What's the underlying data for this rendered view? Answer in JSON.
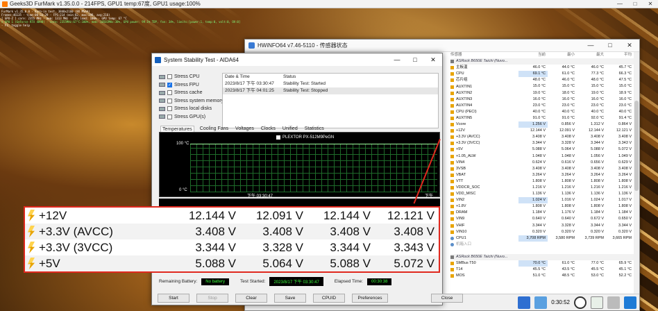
{
  "furmark": {
    "title": "Geeks3D FurMark v1.35.0.0 - 214FPS, GPU1 temp:67度, GPU1 usage:100%",
    "osd": [
      "FurMark v1.35.0.0 - Burn-in test, 3840x2160 (8X MSAA)",
      "Frames:46135 - time:00:33:29 - FPS:214 (min:82, max:298, avg:216)",
      "[ GPU-Z ] core: 2355 MHz - mem: 1313 MHz - GPU load: 100% - GPU temp: 67 °C",
      "> GPU 1 (GeForce RTX 4090) - core: 2355MHz:67°C:100%, mem: 10501MHz:38%, GPU power: 99.1% TDP, fan: 34%, limits:[power:1, temp:0, volt:0, OV:0]",
      "- F1: toggle help"
    ]
  },
  "hwinfo": {
    "title": "HWiNFO64 v7.46-5110 - 传感器状态",
    "headers": [
      "传感器",
      "当前",
      "最小",
      "最大",
      "平均"
    ],
    "rows": [
      {
        "n": "ASRock B650E Taichi (Nuvo...",
        "type": "group"
      },
      {
        "n": "主板温",
        "v": [
          "46.0 °C",
          "44.0 °C",
          "46.0 °C",
          "45.7 °C"
        ]
      },
      {
        "n": "CPU",
        "v": [
          "69.1 °C",
          "61.0 °C",
          "77.3 °C",
          "66.3 °C"
        ],
        "hl": true
      },
      {
        "n": "芯片组",
        "v": [
          "48.0 °C",
          "46.0 °C",
          "48.0 °C",
          "47.5 °C"
        ]
      },
      {
        "n": "AUXTIN1",
        "v": [
          "15.0 °C",
          "15.0 °C",
          "15.0 °C",
          "15.0 °C"
        ]
      },
      {
        "n": "AUXTIN2",
        "v": [
          "19.0 °C",
          "18.0 °C",
          "19.0 °C",
          "18.9 °C"
        ]
      },
      {
        "n": "AUXTIN3",
        "v": [
          "16.0 °C",
          "16.0 °C",
          "16.0 °C",
          "16.0 °C"
        ]
      },
      {
        "n": "AUXTIN4",
        "v": [
          "23.0 °C",
          "23.0 °C",
          "23.0 °C",
          "23.0 °C"
        ]
      },
      {
        "n": "CPU (PECI)",
        "v": [
          "40.0 °C",
          "40.0 °C",
          "40.0 °C",
          "40.0 °C"
        ]
      },
      {
        "n": "AUXTIN5",
        "v": [
          "91.0 °C",
          "91.0 °C",
          "92.0 °C",
          "91.4 °C"
        ]
      },
      {
        "n": "Vcore",
        "v": [
          "1.256 V",
          "0.856 V",
          "1.312 V",
          "0.864 V"
        ],
        "hl": true
      },
      {
        "n": "+12V",
        "v": [
          "12.144 V",
          "12.091 V",
          "12.144 V",
          "12.121 V"
        ]
      },
      {
        "n": "+3.3V (AVCC)",
        "v": [
          "3.408 V",
          "3.408 V",
          "3.408 V",
          "3.408 V"
        ]
      },
      {
        "n": "+3.3V (3VCC)",
        "v": [
          "3.344 V",
          "3.328 V",
          "3.344 V",
          "3.343 V"
        ]
      },
      {
        "n": "+5V",
        "v": [
          "5.088 V",
          "5.064 V",
          "5.088 V",
          "5.072 V"
        ]
      },
      {
        "n": "+1.05_ALW",
        "v": [
          "1.048 V",
          "1.048 V",
          "1.056 V",
          "1.049 V"
        ]
      },
      {
        "n": "VIN4",
        "v": [
          "0.624 V",
          "0.616 V",
          "0.656 V",
          "0.629 V"
        ]
      },
      {
        "n": "3VSB",
        "v": [
          "3.408 V",
          "3.408 V",
          "3.408 V",
          "3.408 V"
        ]
      },
      {
        "n": "VBAT",
        "v": [
          "3.264 V",
          "3.264 V",
          "3.264 V",
          "3.264 V"
        ]
      },
      {
        "n": "VTT",
        "v": [
          "1.808 V",
          "1.808 V",
          "1.808 V",
          "1.808 V"
        ]
      },
      {
        "n": "VDDCR_SOC",
        "v": [
          "1.216 V",
          "1.216 V",
          "1.216 V",
          "1.216 V"
        ]
      },
      {
        "n": "VDD_MISC",
        "v": [
          "1.136 V",
          "1.136 V",
          "1.136 V",
          "1.136 V"
        ]
      },
      {
        "n": "VIN2",
        "v": [
          "1.024 V",
          "1.016 V",
          "1.024 V",
          "1.017 V"
        ],
        "hl": true
      },
      {
        "n": "+1.8V",
        "v": [
          "1.808 V",
          "1.808 V",
          "1.808 V",
          "1.808 V"
        ]
      },
      {
        "n": "DRAM",
        "v": [
          "1.184 V",
          "1.176 V",
          "1.184 V",
          "1.184 V"
        ]
      },
      {
        "n": "VIN9",
        "v": [
          "0.640 V",
          "0.640 V",
          "0.672 V",
          "0.650 V"
        ]
      },
      {
        "n": "VHIF",
        "v": [
          "3.344 V",
          "3.328 V",
          "3.344 V",
          "3.344 V"
        ]
      },
      {
        "n": "VIN10",
        "v": [
          "0.320 V",
          "0.320 V",
          "0.320 V",
          "0.320 V"
        ]
      },
      {
        "n": "CPU1",
        "v": [
          "3,708 RPM",
          "3,580 RPM",
          "3,739 RPM",
          "3,665 RPM"
        ],
        "hl": true,
        "fan": true
      },
      {
        "n": "机箱入口",
        "v": [
          "",
          "",
          "",
          ""
        ],
        "fan": true,
        "dim": true
      },
      {
        "n": "",
        "v": [
          "",
          "",
          "",
          ""
        ],
        "blank": true
      },
      {
        "n": "ASRock B650E Taichi (Nuvo...",
        "type": "group"
      },
      {
        "n": "SMBus T50",
        "v": [
          "70.0 °C",
          "61.0 °C",
          "77.0 °C",
          "65.9 °C"
        ],
        "hl": true
      },
      {
        "n": "T14",
        "v": [
          "45.5 °C",
          "43.5 °C",
          "45.5 °C",
          "45.1 °C"
        ]
      },
      {
        "n": "MOS",
        "v": [
          "51.0 °C",
          "48.5 °C",
          "53.0 °C",
          "52.2 °C"
        ]
      }
    ],
    "time": "0:30:52"
  },
  "aida": {
    "title": "System Stability Test - AIDA64",
    "stress": [
      {
        "label": "Stress CPU",
        "checked": false
      },
      {
        "label": "Stress FPU",
        "checked": true
      },
      {
        "label": "Stress cache",
        "checked": false
      },
      {
        "label": "Stress system memory",
        "checked": false
      },
      {
        "label": "Stress local disks",
        "checked": false
      },
      {
        "label": "Stress GPU(s)",
        "checked": false
      }
    ],
    "log_headers": [
      "Date & Time",
      "Status"
    ],
    "log": [
      {
        "time": "2023/8/17 下午 03:30:47",
        "status": "Stability Test: Started"
      },
      {
        "time": "2023/8/17 下午 04:01:25",
        "status": "Stability Test: Stopped"
      }
    ],
    "tabs": [
      "Temperatures",
      "Cooling Fans",
      "Voltages",
      "Clocks",
      "Unified",
      "Statistics"
    ],
    "graph": {
      "legend": "PLEXTOR PX-512M9PeGN",
      "y_top": "100 °C",
      "y_bottom": "0 °C",
      "x_start": "下午 03:30:47",
      "x_end": "下午 04:01"
    },
    "status": {
      "battery_label": "Remaining Battery:",
      "battery_value": "No battery",
      "started_label": "Test Started:",
      "started_value": "2023/8/17 下午 03:30:47",
      "elapsed_label": "Elapsed Time:",
      "elapsed_value": "00:30:38"
    },
    "buttons": {
      "start": "Start",
      "stop": "Stop",
      "clear": "Clear",
      "save": "Save",
      "cpuid": "CPUID",
      "preferences": "Preferences",
      "close": "Close"
    }
  },
  "zoom": {
    "rows": [
      {
        "name": "+12V",
        "v": [
          "12.144 V",
          "12.091 V",
          "12.144 V",
          "12.121 V"
        ]
      },
      {
        "name": "+3.3V (AVCC)",
        "v": [
          "3.408 V",
          "3.408 V",
          "3.408 V",
          "3.408 V"
        ]
      },
      {
        "name": "+3.3V (3VCC)",
        "v": [
          "3.344 V",
          "3.328 V",
          "3.344 V",
          "3.343 V"
        ]
      },
      {
        "name": "+5V",
        "v": [
          "5.088 V",
          "5.064 V",
          "5.088 V",
          "5.072 V"
        ]
      }
    ]
  }
}
